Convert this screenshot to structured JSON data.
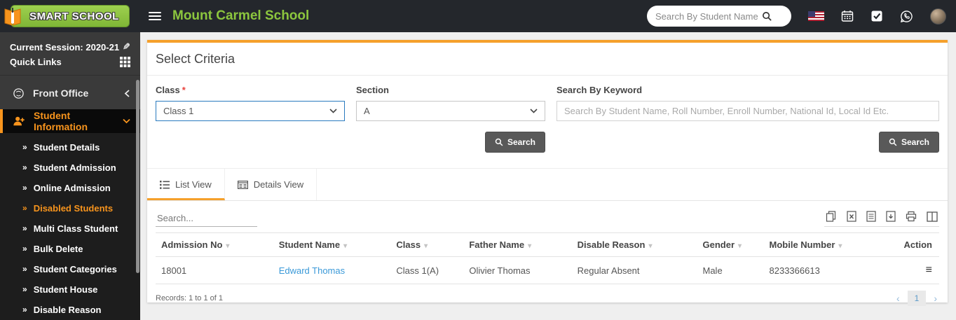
{
  "header": {
    "logo_text": "SMART SCHOOL",
    "school_name": "Mount Carmel School",
    "search_placeholder": "Search By Student Name"
  },
  "sidebar": {
    "session": "Current Session: 2020-21",
    "quick_links": "Quick Links",
    "front_office": "Front Office",
    "student_information": "Student Information",
    "submenu": [
      "Student Details",
      "Student Admission",
      "Online Admission",
      "Disabled Students",
      "Multi Class Student",
      "Bulk Delete",
      "Student Categories",
      "Student House",
      "Disable Reason"
    ],
    "active_submenu": "Disabled Students"
  },
  "icons": {
    "pencil": "✎",
    "submenu_arrow": "»"
  },
  "criteria": {
    "title": "Select Criteria",
    "class_label": "Class",
    "required_mark": "*",
    "class_value": "Class 1",
    "section_label": "Section",
    "section_value": "A",
    "keyword_label": "Search By Keyword",
    "keyword_placeholder": "Search By Student Name, Roll Number, Enroll Number, National Id, Local Id Etc.",
    "search_button": "Search"
  },
  "tabs": {
    "list_view": "List View",
    "details_view": "Details View"
  },
  "toolbar": {
    "search_placeholder": "Search..."
  },
  "table": {
    "headers": [
      "Admission No",
      "Student Name",
      "Class",
      "Father Name",
      "Disable Reason",
      "Gender",
      "Mobile Number",
      "Action"
    ],
    "sort_arrow": "▾",
    "rows": [
      {
        "admission_no": "18001",
        "student_name": "Edward Thomas",
        "class": "Class 1(A)",
        "father_name": "Olivier Thomas",
        "disable_reason": "Regular Absent",
        "gender": "Male",
        "mobile_number": "8233366613",
        "action_icon": "≡"
      }
    ],
    "records_summary": "Records: 1 to 1 of 1"
  },
  "pagination": {
    "prev": "‹",
    "current": "1",
    "next": "›"
  },
  "colors": {
    "header_bg": "#24272c",
    "brand_green": "#8cc63e",
    "accent_orange": "#f7941d",
    "card_top_orange": "#f5a02b",
    "sidebar_bg": "#3a3a3a",
    "submenu_bg": "#1d1d1d",
    "link_blue": "#3a99d8",
    "button_gray": "#595959"
  }
}
